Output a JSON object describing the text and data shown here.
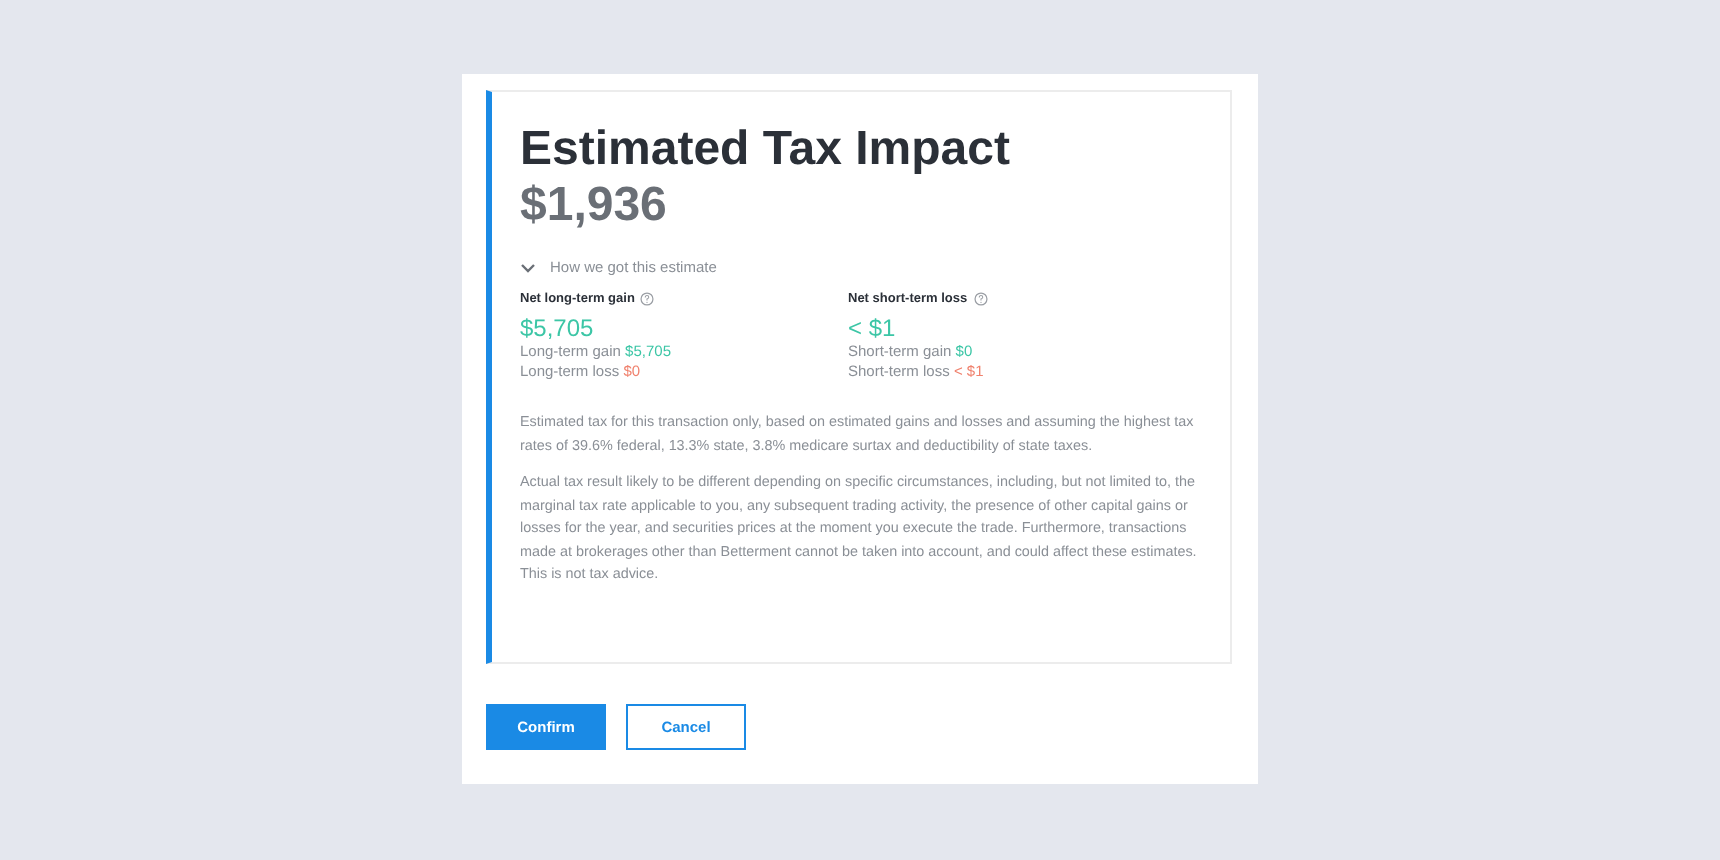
{
  "title": "Estimated Tax Impact",
  "amount": "$1,936",
  "details": {
    "toggle": "How we got this estimate",
    "expanded": true,
    "columns": [
      {
        "heading": "Net long-term gain",
        "total": {
          "value": "$5,705",
          "kind": "gain"
        },
        "lines": [
          {
            "label": "Long-term gain",
            "value": "$5,705",
            "kind": "gain"
          },
          {
            "label": "Long-term loss",
            "value": "$0",
            "kind": "loss"
          }
        ]
      },
      {
        "heading": "Net short-term loss",
        "total": {
          "value": "< $1",
          "kind": "gain"
        },
        "lines": [
          {
            "label": "Short-term gain",
            "value": "$0",
            "kind": "gain"
          },
          {
            "label": "Short-term loss",
            "value": "< $1",
            "kind": "loss"
          }
        ]
      }
    ]
  },
  "notes": [
    "Estimated tax for this transaction only, based on estimated gains and losses and assuming the highest tax rates of 39.6% federal, 13.3% state, 3.8% medicare surtax and deductibility of state taxes.",
    "Actual tax result likely to be different depending on specific circumstances, including, but not limited to, the marginal tax rate applicable to you, any subsequent trading activity, the presence of other capital gains or losses for the year, and securities prices at the moment you execute the trade. Furthermore, transactions made at brokerages other than Betterment cannot be taken into account, and could affect these estimates. This is not tax advice."
  ],
  "buttons": [
    {
      "label": "Confirm",
      "kind": "primary"
    },
    {
      "label": "Cancel",
      "kind": "secondary"
    }
  ]
}
